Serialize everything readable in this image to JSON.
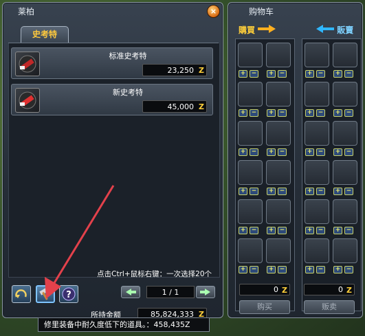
{
  "shop": {
    "title": "莱柏",
    "close_label": "×",
    "tab_label": "史考特",
    "items": [
      {
        "name": "标准史考特",
        "price": "23,250"
      },
      {
        "name": "新史考特",
        "price": "45,000"
      }
    ],
    "hint": "点击Ctrl+鼠标右键：一次选择20个",
    "page": "1 / 1",
    "money_label": "所持金额",
    "money": "85,824,333",
    "currency": "Z",
    "tooltip": "修里装备中耐久度低下的道具。：458,435Z"
  },
  "cart": {
    "title": "购物车",
    "buy_header": "購買",
    "sell_header": "販賣",
    "buy_total": "0",
    "sell_total": "0",
    "buy_button": "购买",
    "sell_button": "贩卖",
    "plus": "+",
    "minus": "−"
  },
  "icons": {
    "shop_action_1": "repair-all-icon",
    "shop_action_2": "hammer-repair-icon",
    "shop_action_3": "help-icon",
    "prev": "arrow-left-icon",
    "next": "arrow-right-icon"
  },
  "colors": {
    "accent": "#ffcf3a",
    "sell_arrow": "#2fb7ff"
  }
}
